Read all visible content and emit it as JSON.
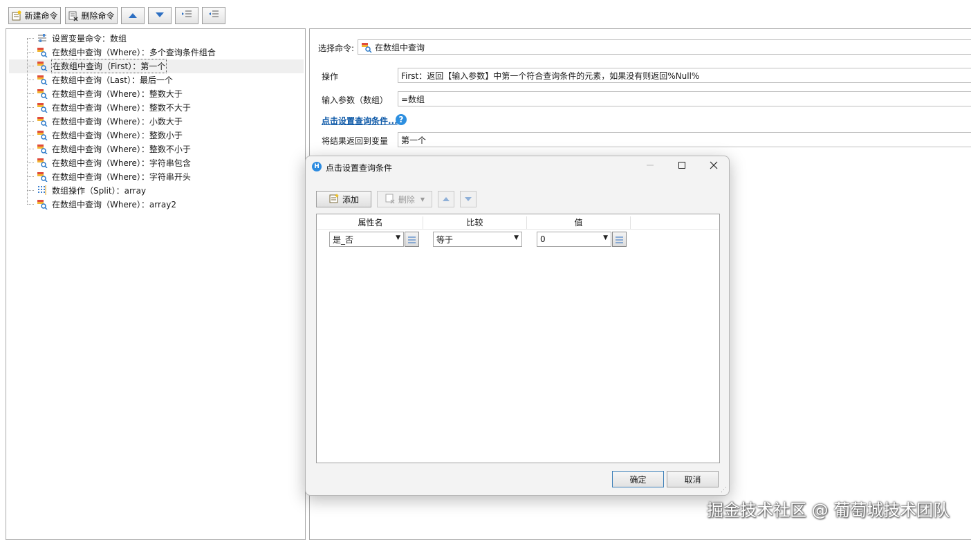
{
  "toolbar": {
    "new_command": "新建命令",
    "delete_command": "删除命令"
  },
  "tree": {
    "items": [
      {
        "label": "设置变量命令：数组",
        "icon": "variable-setter-icon"
      },
      {
        "label": "在数组中查询（Where）：多个查询条件组合",
        "icon": "array-query-icon"
      },
      {
        "label": "在数组中查询（First）：第一个",
        "icon": "array-query-icon",
        "selected": true
      },
      {
        "label": "在数组中查询（Last）：最后一个",
        "icon": "array-query-icon"
      },
      {
        "label": "在数组中查询（Where）：整数大于",
        "icon": "array-query-icon"
      },
      {
        "label": "在数组中查询（Where）：整数不大于",
        "icon": "array-query-icon"
      },
      {
        "label": "在数组中查询（Where）：小数大于",
        "icon": "array-query-icon"
      },
      {
        "label": "在数组中查询（Where）：整数小于",
        "icon": "array-query-icon"
      },
      {
        "label": "在数组中查询（Where）：整数不小于",
        "icon": "array-query-icon"
      },
      {
        "label": "在数组中查询（Where）：字符串包含",
        "icon": "array-query-icon"
      },
      {
        "label": "在数组中查询（Where）：字符串开头",
        "icon": "array-query-icon"
      },
      {
        "label": "数组操作（Split）：array",
        "icon": "array-split-icon"
      },
      {
        "label": "在数组中查询（Where）：array2",
        "icon": "array-query-icon"
      }
    ]
  },
  "props": {
    "select_command_label": "选择命令:",
    "select_command_value": "在数组中查询",
    "operation_label": "操作",
    "operation_value": "First：返回【输入参数】中第一个符合查询条件的元素，如果没有则返回%Null%",
    "input_label": "输入参数（数组）",
    "input_value": "=数组",
    "set_condition_link": "点击设置查询条件...",
    "result_label": "将结果返回到变量",
    "result_value": "第一个"
  },
  "dialog": {
    "title": "点击设置查询条件",
    "add_label": "添加",
    "delete_label": "删除",
    "columns": [
      "属性名",
      "比较",
      "值"
    ],
    "row": {
      "property": "是_否",
      "compare": "等于",
      "value": "0"
    },
    "ok_label": "确定",
    "cancel_label": "取消"
  },
  "watermark": "掘金技术社区 @ 葡萄城技术团队",
  "colors": {
    "accent": "#2c8be0",
    "link": "#0f5aa8",
    "selection": "#efefef"
  }
}
